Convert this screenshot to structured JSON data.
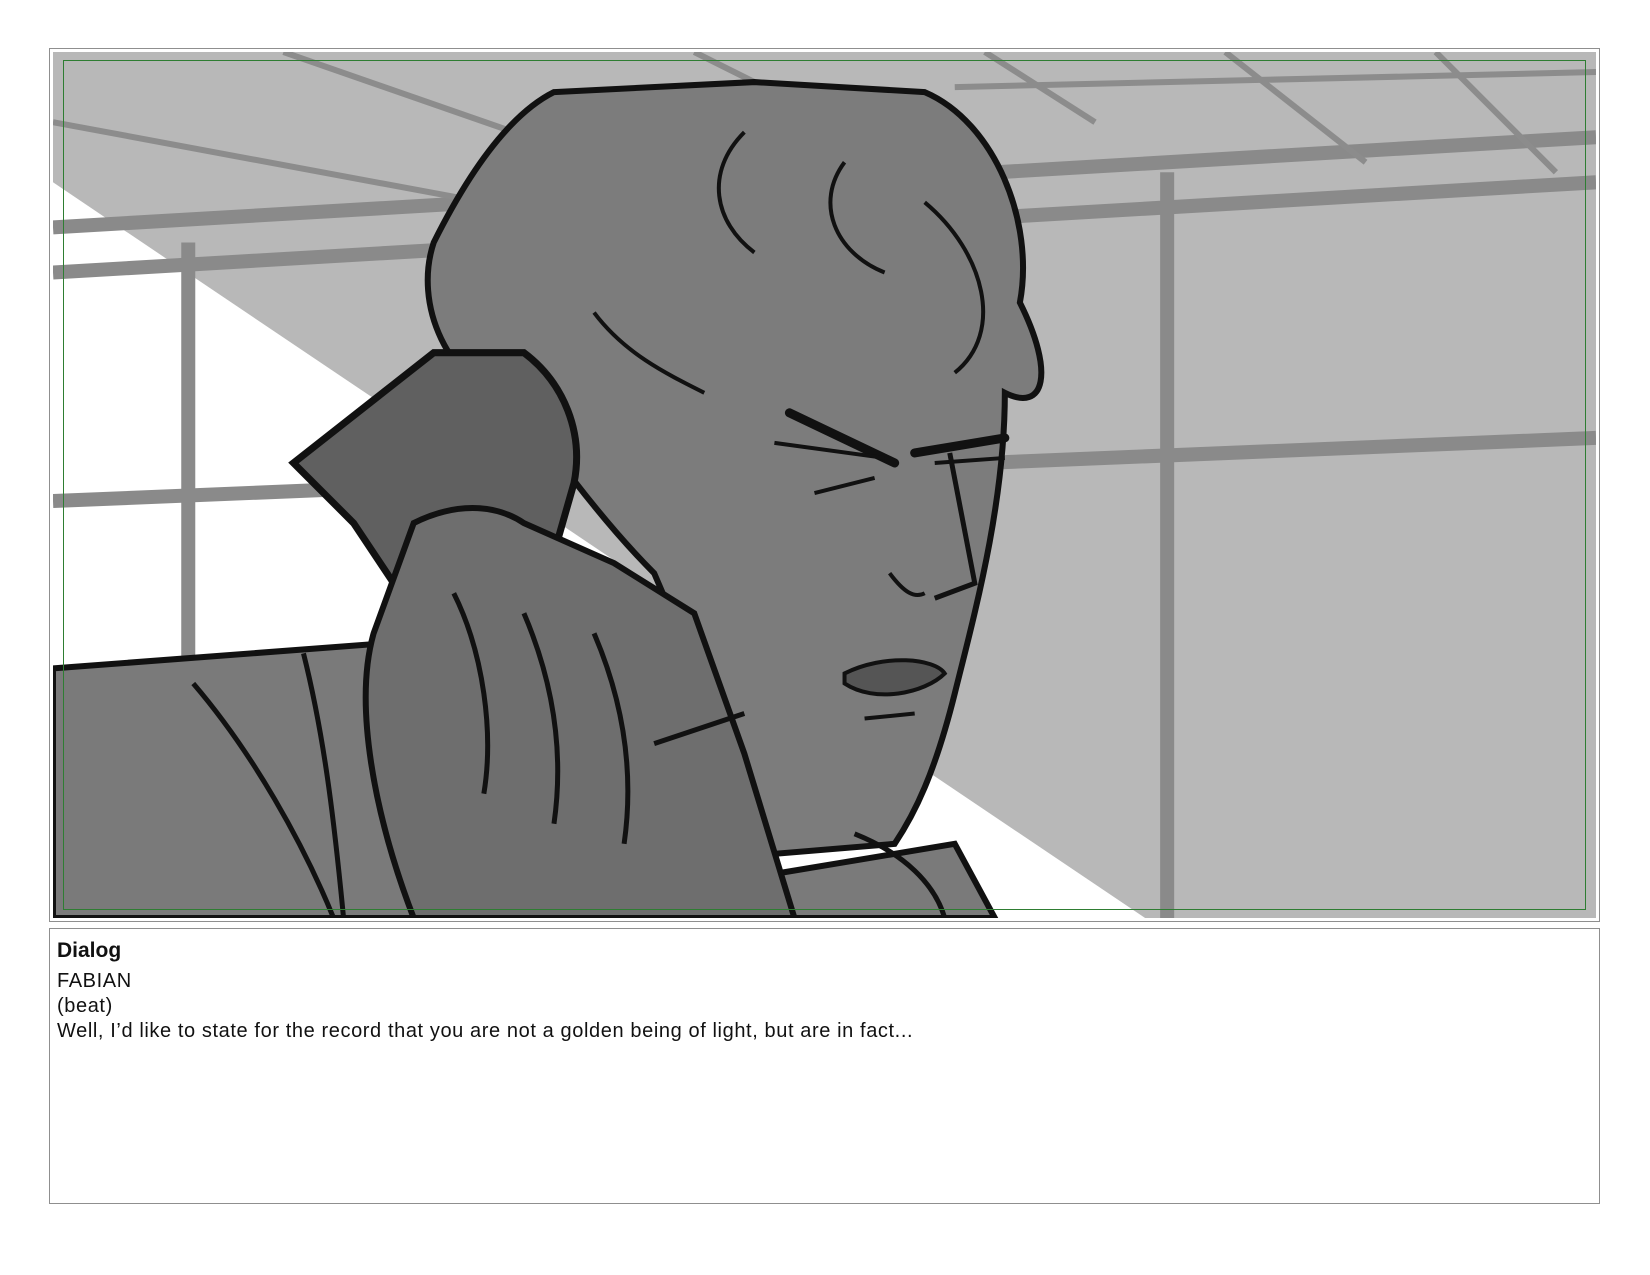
{
  "dialog": {
    "heading": "Dialog",
    "character": "FABIAN",
    "parenthetical": "(beat)",
    "line": "Well, I’d like to state for the record that you are not a golden being of light, but are in fact..."
  },
  "panel": {
    "image_subject": "storyboard-sketch-man-on-phone",
    "guide_color": "#2e7d32",
    "border_color": "#8f8f8f"
  }
}
